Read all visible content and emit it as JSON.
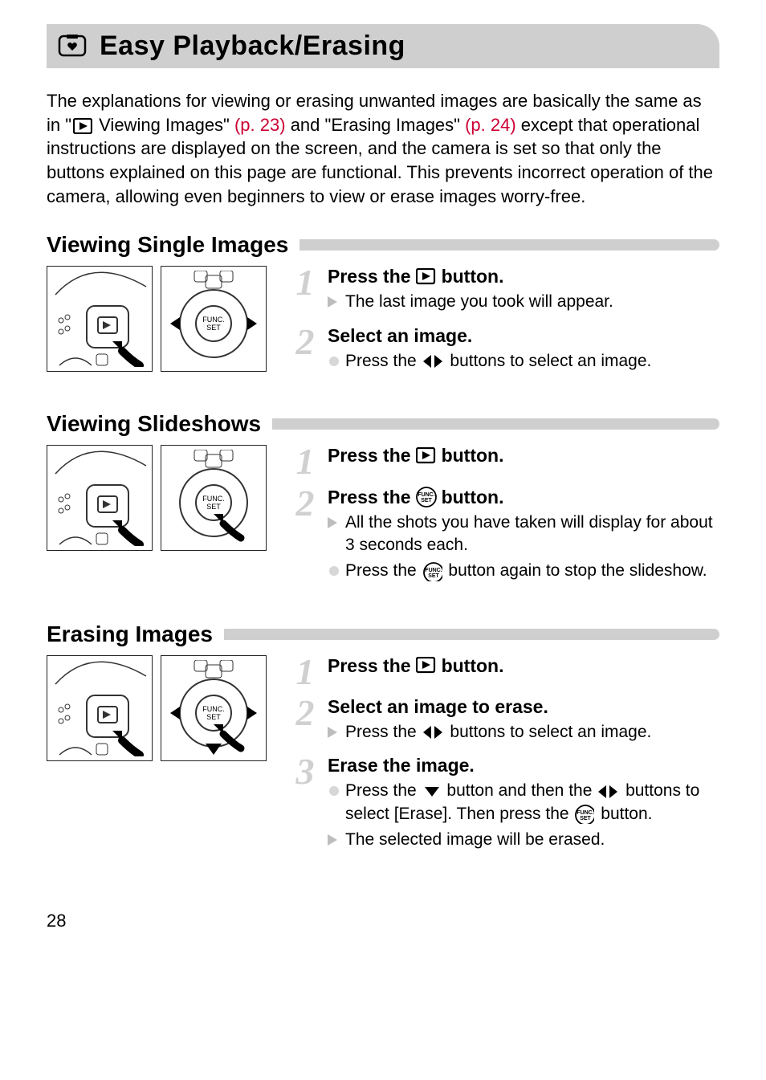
{
  "title": "Easy Playback/Erasing",
  "intro": {
    "t1": "The explanations for viewing or erasing unwanted images are basically the same as in \"",
    "t2": " Viewing Images\" ",
    "ref1": "(p. 23)",
    "t3": " and \"Erasing Images\" ",
    "ref2": "(p. 24)",
    "t4": " except that operational instructions are displayed on the screen, and the camera is set so that only the buttons explained on this page are functional. This prevents incorrect operation of the camera, allowing even beginners to view or erase images worry-free."
  },
  "sections": {
    "viewing_single": {
      "heading": "Viewing Single Images",
      "step1": {
        "pre": "Press the ",
        "post": " button."
      },
      "step1_detail": "The last image you took will appear.",
      "step2_title": "Select an image.",
      "step2_detail_pre": "Press the ",
      "step2_detail_post": " buttons to select an image."
    },
    "viewing_slideshows": {
      "heading": "Viewing Slideshows",
      "step1": {
        "pre": "Press the ",
        "post": " button."
      },
      "step2": {
        "pre": "Press the ",
        "post": " button."
      },
      "step2_detail1": "All the shots you have taken will display for about 3 seconds each.",
      "step2_detail2_pre": "Press the ",
      "step2_detail2_post": " button again to stop the slideshow."
    },
    "erasing": {
      "heading": "Erasing Images",
      "step1": {
        "pre": "Press the ",
        "post": " button."
      },
      "step2_title": "Select an image to erase.",
      "step2_detail_pre": "Press the ",
      "step2_detail_post": " buttons to select an image.",
      "step3_title": "Erase the image.",
      "step3_detail1_pre": "Press the ",
      "step3_detail1_mid": " button and then the ",
      "step3_detail1_post": " buttons to select [Erase]. Then press the ",
      "step3_detail1_end": " button.",
      "step3_detail2": "The selected image will be erased."
    }
  },
  "page_number": "28"
}
